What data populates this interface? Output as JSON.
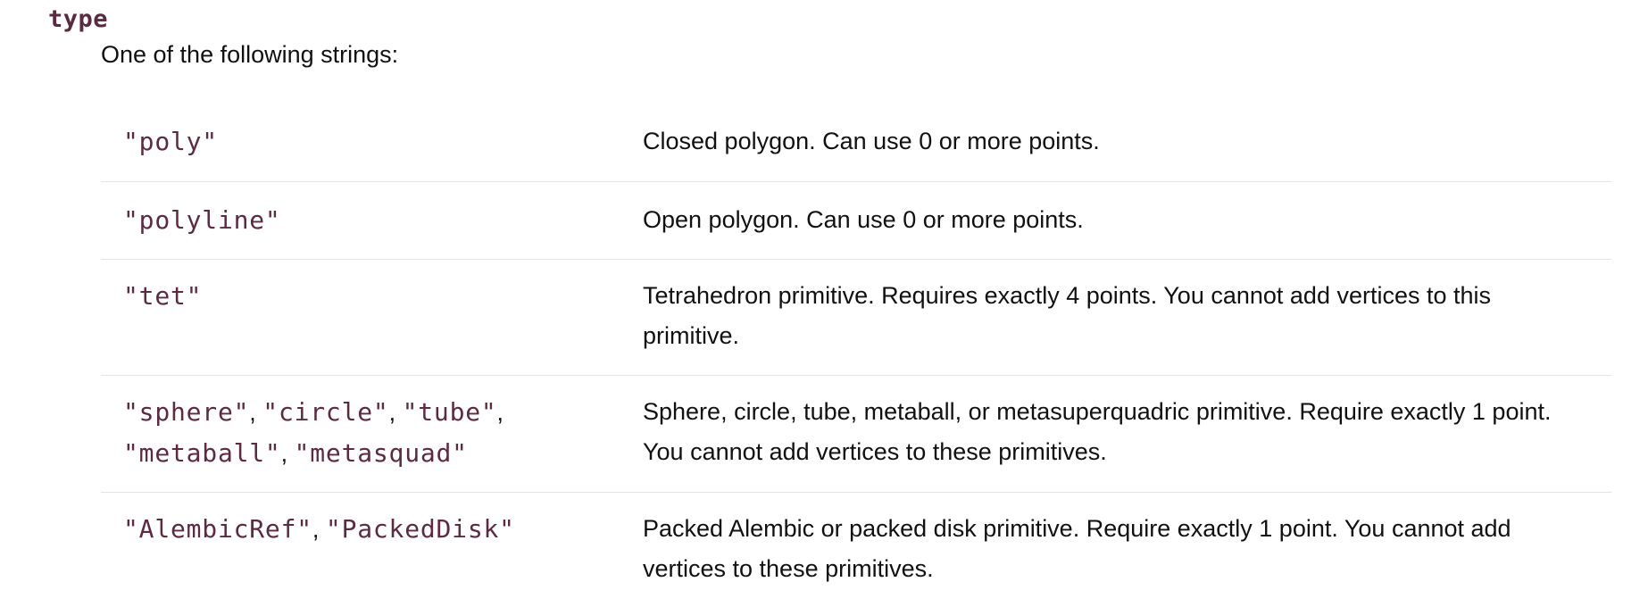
{
  "term": "type",
  "intro": "One of the following strings:",
  "rows": [
    {
      "codes": [
        "\"poly\""
      ],
      "description": "Closed polygon. Can use 0 or more points."
    },
    {
      "codes": [
        "\"polyline\""
      ],
      "description": "Open polygon. Can use 0 or more points."
    },
    {
      "codes": [
        "\"tet\""
      ],
      "description": "Tetrahedron primitive. Requires exactly 4 points. You cannot add vertices to this primitive."
    },
    {
      "codes": [
        "\"sphere\"",
        "\"circle\"",
        "\"tube\"",
        "\"metaball\"",
        "\"metasquad\""
      ],
      "separator": ",",
      "description": "Sphere, circle, tube, metaball, or metasuperquadric primitive. Require exactly 1 point. You cannot add vertices to these primitives."
    },
    {
      "codes": [
        "\"AlembicRef\"",
        "\"PackedDisk\""
      ],
      "separator": ",",
      "description": "Packed Alembic or packed disk primitive. Require exactly 1 point. You cannot add vertices to these primitives."
    }
  ]
}
